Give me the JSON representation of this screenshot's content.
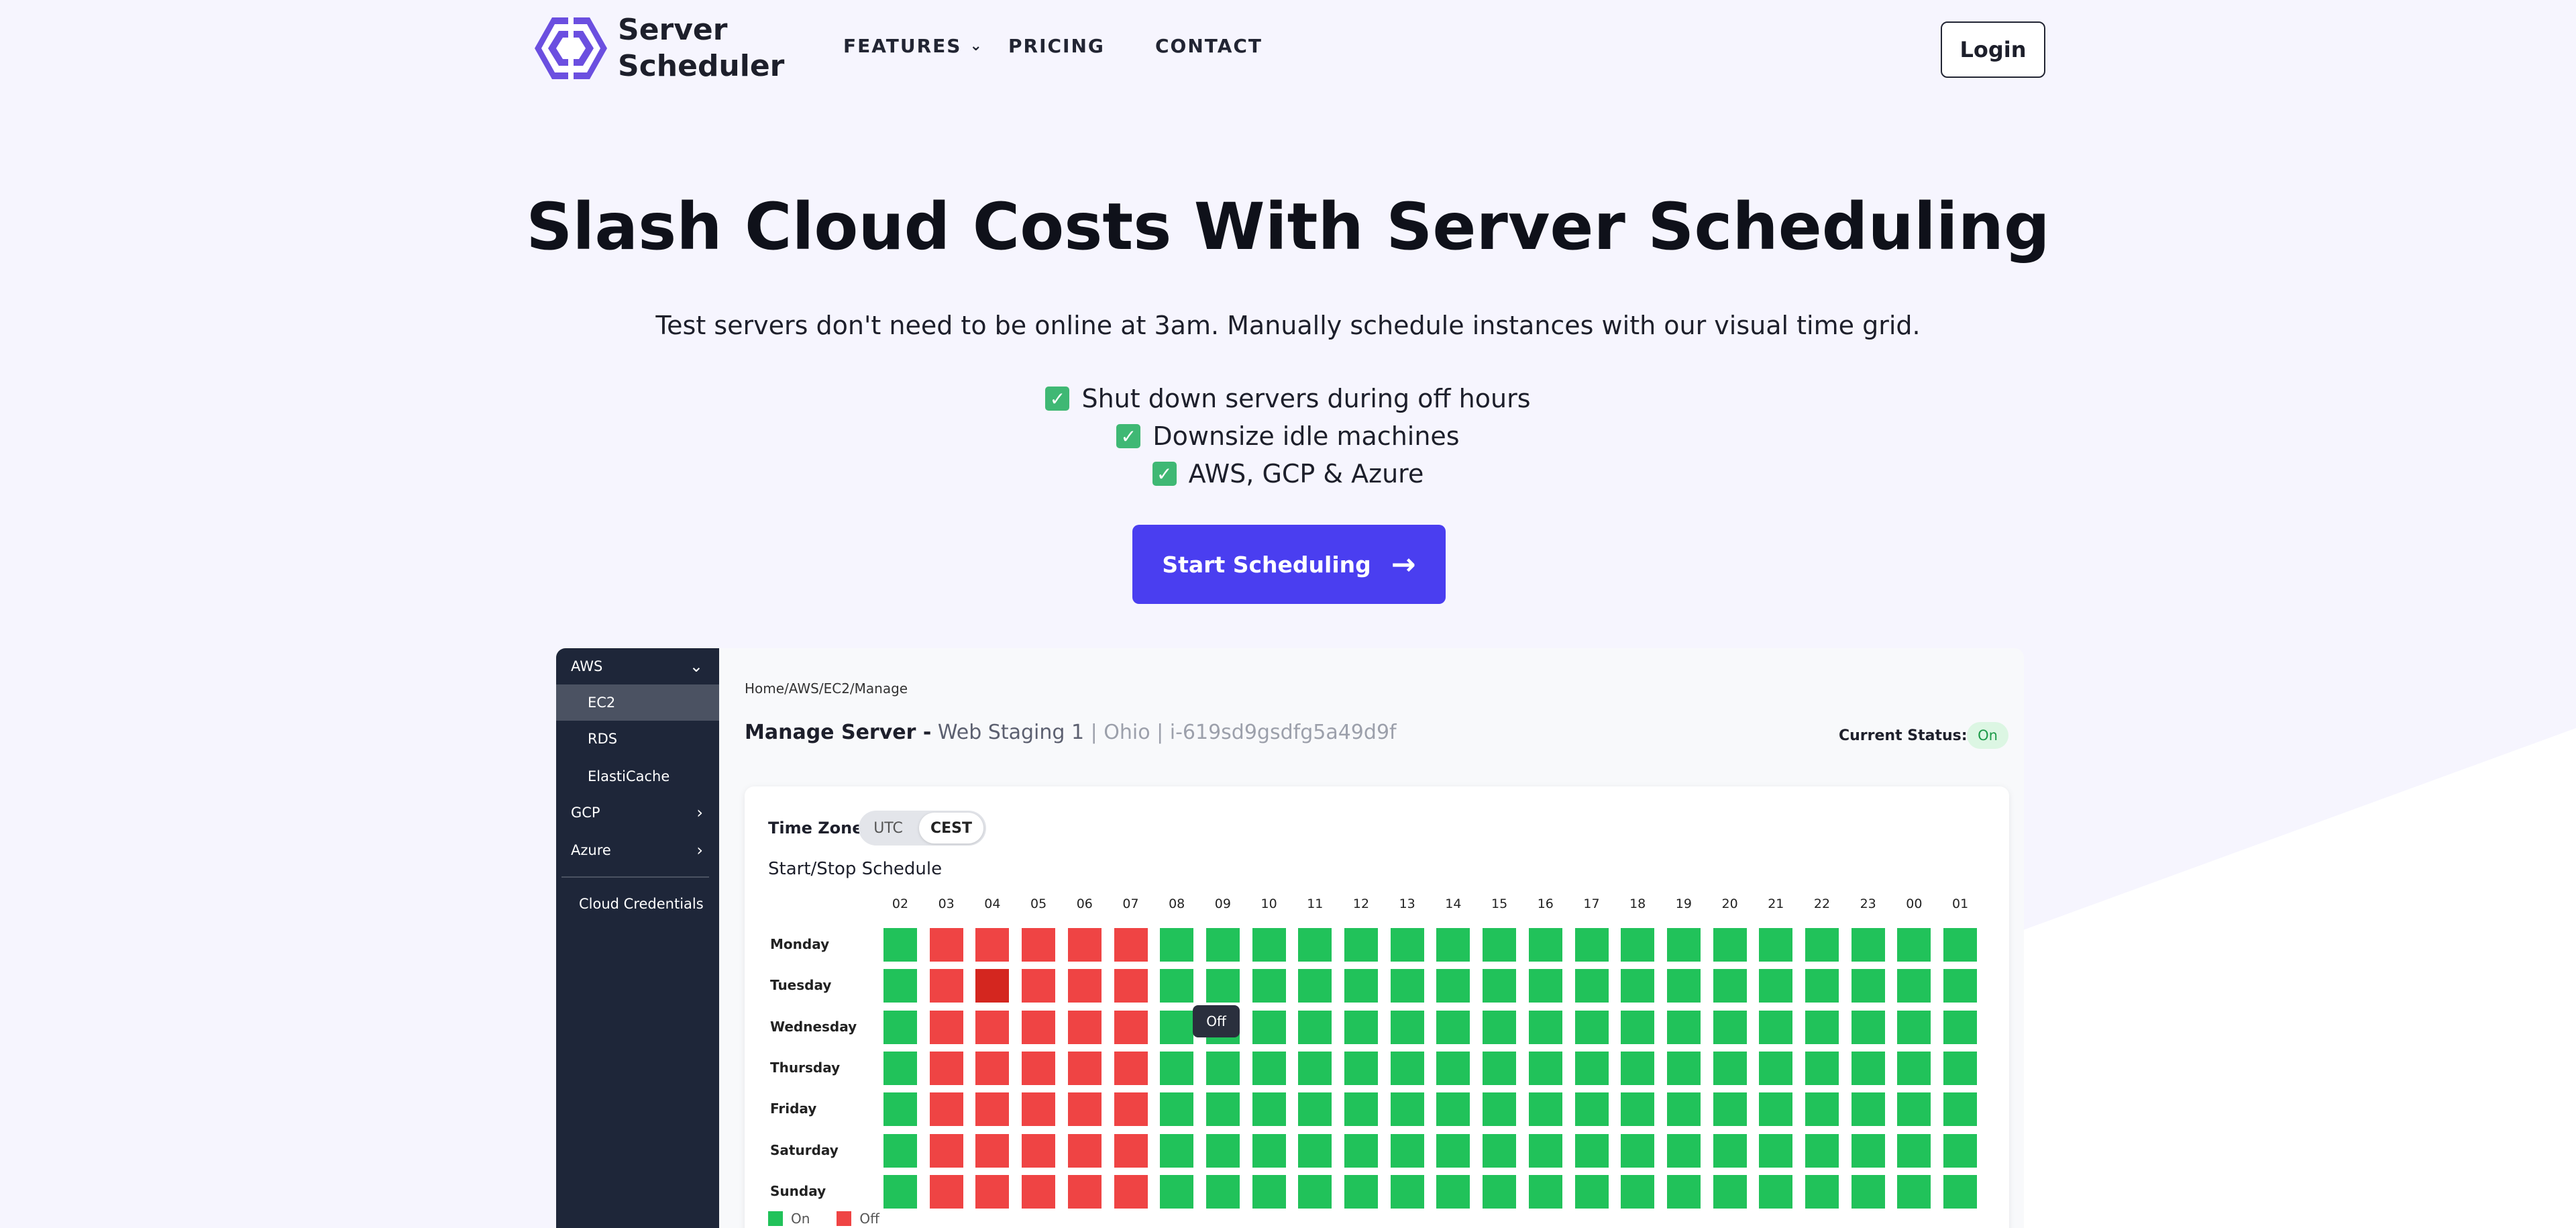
{
  "colors": {
    "accent": "#4a3ef0",
    "on": "#21c25a",
    "off": "#ef4444",
    "sidebar": "#1e2639"
  },
  "nav": {
    "brand_line1": "Server",
    "brand_line2": "Scheduler",
    "links": [
      "FEATURES",
      "PRICING",
      "CONTACT"
    ],
    "features_chevron_icon": "chevron-down-icon",
    "login": "Login"
  },
  "hero": {
    "title": "Slash Cloud Costs With Server Scheduling",
    "subtitle": "Test servers don't need to be online at 3am. Manually schedule instances with our visual time grid.",
    "features": [
      "Shut down servers during off hours",
      "Downsize idle machines",
      "AWS, GCP & Azure"
    ],
    "cta": "Start Scheduling",
    "cta_icon": "arrow-right-icon"
  },
  "app": {
    "sidebar": {
      "aws": "AWS",
      "aws_items": [
        "EC2",
        "RDS",
        "ElastiCache"
      ],
      "gcp": "GCP",
      "azure": "Azure",
      "credentials": "Cloud Credentials",
      "active": "EC2"
    },
    "breadcrumb": "Home/AWS/EC2/Manage",
    "manage_label": "Manage Server -",
    "server_name": "Web Staging 1",
    "server_meta": "| Ohio | i-619sd9gsdfg5a49d9f",
    "status_label": "Current Status:",
    "status_value": "On",
    "timezone_label": "Time Zone:",
    "timezone_options": [
      "UTC",
      "CEST"
    ],
    "timezone_selected": "CEST",
    "schedule_title": "Start/Stop Schedule",
    "hours": [
      "02",
      "03",
      "04",
      "05",
      "06",
      "07",
      "08",
      "09",
      "10",
      "11",
      "12",
      "13",
      "14",
      "15",
      "16",
      "17",
      "18",
      "19",
      "20",
      "21",
      "22",
      "23",
      "00",
      "01"
    ],
    "days": [
      "Monday",
      "Tuesday",
      "Wednesday",
      "Thursday",
      "Friday",
      "Saturday",
      "Sunday"
    ],
    "grid": [
      [
        1,
        0,
        0,
        0,
        0,
        0,
        1,
        1,
        1,
        1,
        1,
        1,
        1,
        1,
        1,
        1,
        1,
        1,
        1,
        1,
        1,
        1,
        1,
        1
      ],
      [
        1,
        0,
        0,
        0,
        0,
        0,
        1,
        1,
        1,
        1,
        1,
        1,
        1,
        1,
        1,
        1,
        1,
        1,
        1,
        1,
        1,
        1,
        1,
        1
      ],
      [
        1,
        0,
        0,
        0,
        0,
        0,
        1,
        1,
        1,
        1,
        1,
        1,
        1,
        1,
        1,
        1,
        1,
        1,
        1,
        1,
        1,
        1,
        1,
        1
      ],
      [
        1,
        0,
        0,
        0,
        0,
        0,
        1,
        1,
        1,
        1,
        1,
        1,
        1,
        1,
        1,
        1,
        1,
        1,
        1,
        1,
        1,
        1,
        1,
        1
      ],
      [
        1,
        0,
        0,
        0,
        0,
        0,
        1,
        1,
        1,
        1,
        1,
        1,
        1,
        1,
        1,
        1,
        1,
        1,
        1,
        1,
        1,
        1,
        1,
        1
      ],
      [
        1,
        0,
        0,
        0,
        0,
        0,
        1,
        1,
        1,
        1,
        1,
        1,
        1,
        1,
        1,
        1,
        1,
        1,
        1,
        1,
        1,
        1,
        1,
        1
      ],
      [
        1,
        0,
        0,
        0,
        0,
        0,
        1,
        1,
        1,
        1,
        1,
        1,
        1,
        1,
        1,
        1,
        1,
        1,
        1,
        1,
        1,
        1,
        1,
        1
      ]
    ],
    "hovered_cell": {
      "day": "Tuesday",
      "hour": "04"
    },
    "tooltip": "Off",
    "legend_on": "On",
    "legend_off": "Off"
  }
}
